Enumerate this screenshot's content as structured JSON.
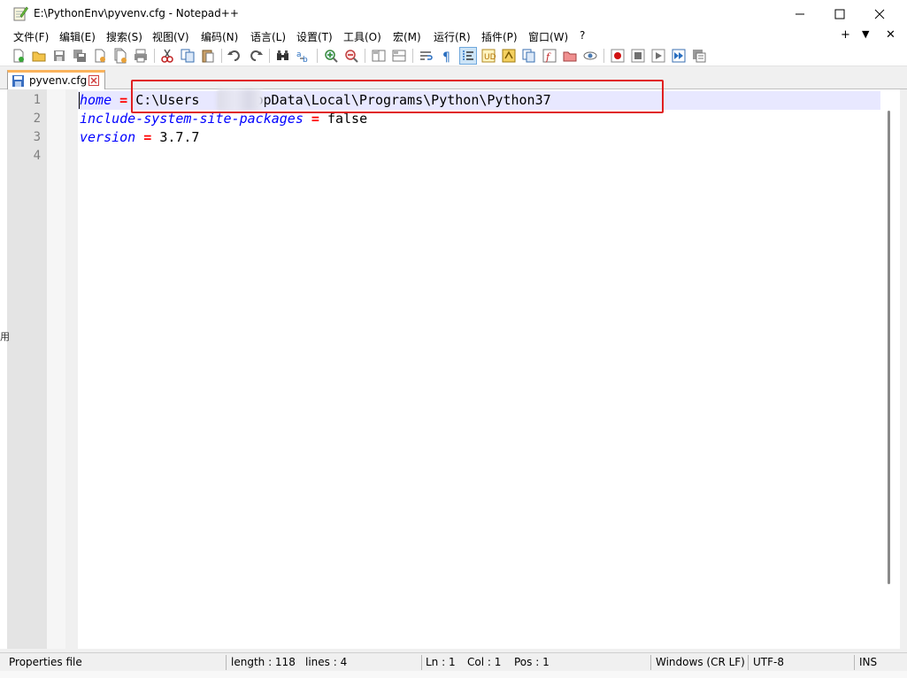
{
  "window": {
    "title": "E:\\PythonEnv\\pyvenv.cfg - Notepad++",
    "min_symbol": "—",
    "max_symbol": "☐",
    "close_symbol": "✕"
  },
  "menu": {
    "items": [
      "文件(F)",
      "编辑(E)",
      "搜索(S)",
      "视图(V)",
      "编码(N)",
      "语言(L)",
      "设置(T)",
      "工具(O)",
      "宏(M)",
      "运行(R)",
      "插件(P)",
      "窗口(W)",
      "?"
    ],
    "right_plus": "+",
    "right_down": "▼",
    "right_close": "✕"
  },
  "toolbar": {
    "icons": [
      "new-file-icon",
      "open-file-icon",
      "save-icon",
      "save-all-icon",
      "close-icon",
      "close-all-icon",
      "print-icon",
      "cut-icon",
      "copy-icon",
      "paste-icon",
      "undo-icon",
      "redo-icon",
      "find-icon",
      "replace-icon",
      "zoom-in-icon",
      "zoom-out-icon",
      "sync-vertical-icon",
      "sync-horizontal-icon",
      "word-wrap-icon",
      "show-all-chars-icon",
      "indent-guide-icon",
      "user-lang-icon",
      "doc-map-icon",
      "doc-list-icon",
      "function-list-icon",
      "folder-workspace-icon",
      "monitoring-icon",
      "record-macro-icon",
      "stop-record-icon",
      "playback-icon",
      "run-macro-multiple-icon",
      "save-macro-icon"
    ],
    "active_icon": "indent-guide-icon"
  },
  "tabs": [
    {
      "label": "pyvenv.cfg",
      "active": true
    }
  ],
  "editor": {
    "line_numbers": [
      "1",
      "2",
      "3",
      "4"
    ],
    "lines": [
      {
        "key": "home",
        "op": "=",
        "value": "C:\\Users\\     \\AppData\\Local\\Programs\\Python\\Python37"
      },
      {
        "key": "include-system-site-packages",
        "op": "=",
        "value": "false"
      },
      {
        "key": "version",
        "op": "=",
        "value": "3.7.7"
      }
    ],
    "value_pre_blur": "C:\\Users",
    "value_post_blur": "AppData\\Local\\Programs\\Python\\Python37",
    "highlight_color": "#e02020"
  },
  "statusbar": {
    "file_type": "Properties file",
    "length": "length : 118",
    "lines": "lines : 4",
    "ln": "Ln : 1",
    "col": "Col : 1",
    "pos": "Pos : 1",
    "eol": "Windows (CR LF)",
    "encoding": "UTF-8",
    "mode": "INS"
  },
  "left_edge_glyph": "用"
}
